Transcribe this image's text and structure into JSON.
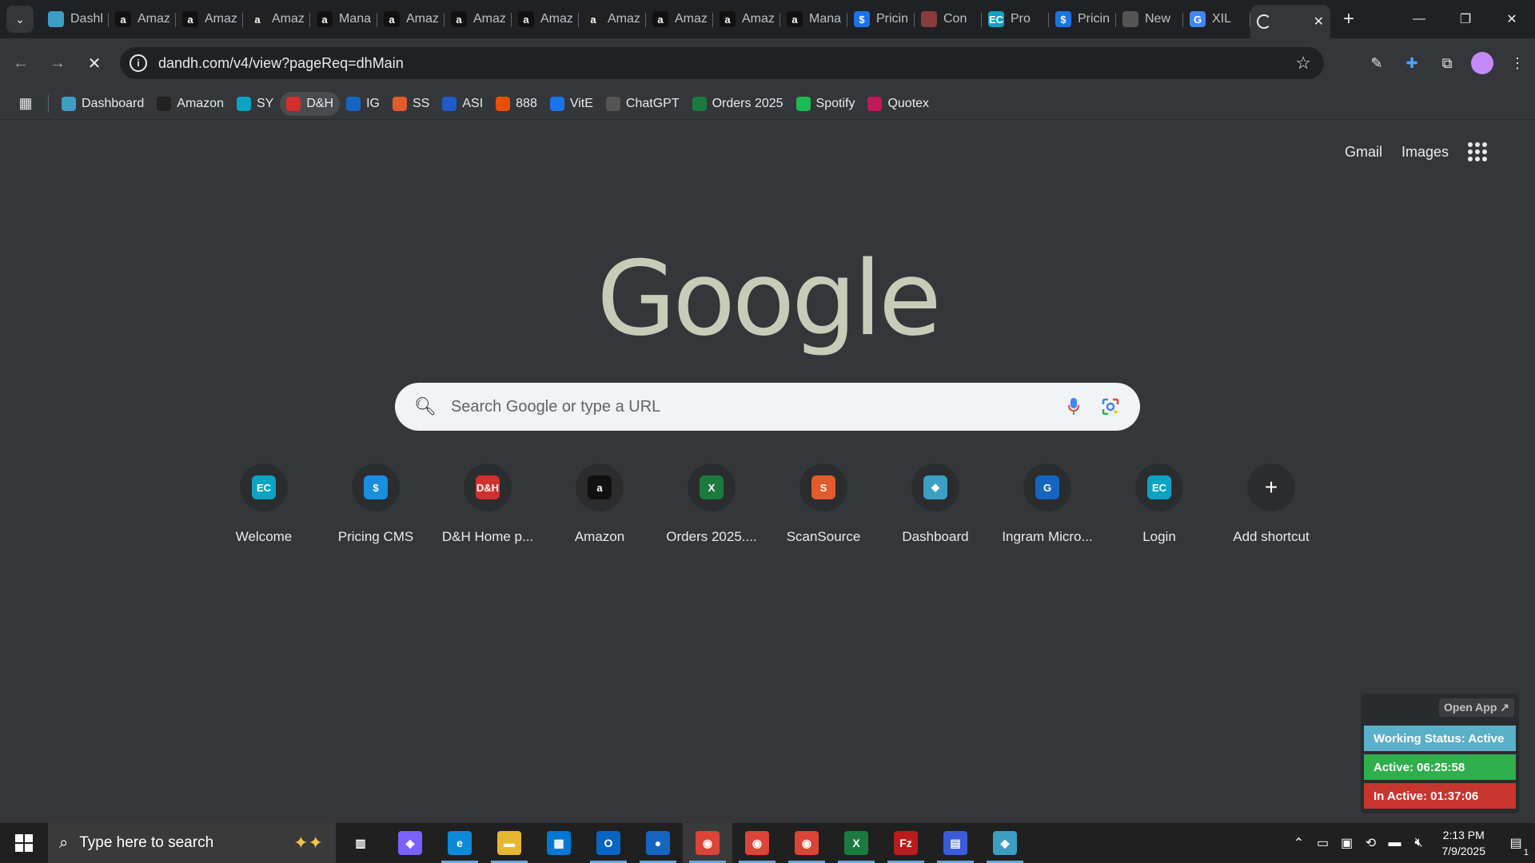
{
  "tabs": [
    {
      "title": "Dashboard",
      "icon": "dashboard-diamond-icon",
      "color": "#3d9ec4"
    },
    {
      "title": "Amazon",
      "icon": "amazon-icon",
      "color": "#111"
    },
    {
      "title": "Amazon",
      "icon": "amazon-icon",
      "color": "#111"
    },
    {
      "title": "Amazon",
      "icon": "amazon-icon",
      "color": "#222"
    },
    {
      "title": "Manage",
      "icon": "amazon-icon",
      "color": "#111"
    },
    {
      "title": "Amazon",
      "icon": "amazon-icon",
      "color": "#111"
    },
    {
      "title": "Amazon",
      "icon": "amazon-icon",
      "color": "#111"
    },
    {
      "title": "Amazon",
      "icon": "amazon-icon",
      "color": "#111"
    },
    {
      "title": "Amazon",
      "icon": "amazon-icon",
      "color": "#222"
    },
    {
      "title": "Amazon",
      "icon": "amazon-icon",
      "color": "#111"
    },
    {
      "title": "Amazon",
      "icon": "amazon-icon",
      "color": "#111"
    },
    {
      "title": "Manage",
      "icon": "amazon-icon",
      "color": "#111"
    },
    {
      "title": "Pricing",
      "icon": "dollar-icon",
      "color": "#1a73e8"
    },
    {
      "title": "Con",
      "icon": "chart-icon",
      "color": "#8a3b3b"
    },
    {
      "title": "Pro",
      "icon": "ec-icon",
      "color": "#0aa3c2"
    },
    {
      "title": "Pricing",
      "icon": "dollar-icon",
      "color": "#1a73e8"
    },
    {
      "title": "New",
      "icon": "chatgpt-icon",
      "color": "#555"
    },
    {
      "title": "XIL",
      "icon": "google-icon",
      "color": "#4285f4"
    }
  ],
  "active_tab": {
    "title": "",
    "status": "loading"
  },
  "address": {
    "url": "dandh.com/v4/view?pageReq=dhMain"
  },
  "bookmarks": [
    {
      "label": "Dashboard",
      "color": "#3d9ec4"
    },
    {
      "label": "Amazon",
      "color": "#222"
    },
    {
      "label": "SY",
      "color": "#0aa3c2"
    },
    {
      "label": "D&H",
      "color": "#d32f2f",
      "highlight": true
    },
    {
      "label": "IG",
      "color": "#1565c0"
    },
    {
      "label": "SS",
      "color": "#e25b2c"
    },
    {
      "label": "ASI",
      "color": "#1e5bc6"
    },
    {
      "label": "888",
      "color": "#e65100"
    },
    {
      "label": "VitE",
      "color": "#1a73e8"
    },
    {
      "label": "ChatGPT",
      "color": "#555"
    },
    {
      "label": "Orders 2025",
      "color": "#1d7a3e"
    },
    {
      "label": "Spotify",
      "color": "#1db954"
    },
    {
      "label": "Quotex",
      "color": "#c2185b"
    }
  ],
  "ntp": {
    "gmail": "Gmail",
    "images": "Images",
    "logo": "Google",
    "search_placeholder": "Search Google or type a URL",
    "shortcuts": [
      {
        "label": "Welcome",
        "icon": "ec-icon",
        "glyph": "EC",
        "color": "#0aa3c2"
      },
      {
        "label": "Pricing CMS",
        "icon": "dollar-icon",
        "glyph": "$",
        "color": "#1a8fe0"
      },
      {
        "label": "D&H Home p...",
        "icon": "dandh-icon",
        "glyph": "D&H",
        "color": "#d32f2f"
      },
      {
        "label": "Amazon",
        "icon": "amazon-icon",
        "glyph": "a",
        "color": "#111"
      },
      {
        "label": "Orders 2025....",
        "icon": "excel-icon",
        "glyph": "X",
        "color": "#1d7a3e"
      },
      {
        "label": "ScanSource",
        "icon": "scansource-icon",
        "glyph": "S",
        "color": "#e25b2c"
      },
      {
        "label": "Dashboard",
        "icon": "dashboard-diamond-icon",
        "glyph": "◆",
        "color": "#3d9ec4"
      },
      {
        "label": "Ingram Micro...",
        "icon": "ingram-icon",
        "glyph": "G",
        "color": "#1565c0"
      },
      {
        "label": "Login",
        "icon": "ec-icon",
        "glyph": "EC",
        "color": "#0aa3c2"
      },
      {
        "label": "Add shortcut",
        "icon": "plus-icon",
        "glyph": "+",
        "color": "#2b2c2e"
      }
    ]
  },
  "widget": {
    "open_app": "Open App ↗",
    "working_status": "Working Status: Active",
    "active": "Active: 06:25:58",
    "inactive": "In Active: 01:37:06",
    "colors": {
      "status": "#5ab0c8",
      "active": "#2fae4c",
      "inactive": "#c8352e"
    }
  },
  "taskbar": {
    "search_placeholder": "Type here to search",
    "time": "2:13 PM",
    "date": "7/9/2025",
    "notification_count": "1",
    "apps": [
      {
        "name": "task-view",
        "glyph": "▥",
        "color": "transparent"
      },
      {
        "name": "copilot",
        "glyph": "◈",
        "color": "#7b61ff"
      },
      {
        "name": "edge",
        "glyph": "e",
        "color": "#0c8ad8"
      },
      {
        "name": "file-explorer",
        "glyph": "▬",
        "color": "#e8b730"
      },
      {
        "name": "store",
        "glyph": "▦",
        "color": "#0078d4"
      },
      {
        "name": "outlook",
        "glyph": "O",
        "color": "#0a64c2"
      },
      {
        "name": "calendar",
        "glyph": "●",
        "color": "#1565c0"
      },
      {
        "name": "chrome",
        "glyph": "◉",
        "color": "#db4437"
      },
      {
        "name": "chrome-2",
        "glyph": "◉",
        "color": "#db4437"
      },
      {
        "name": "chrome-3",
        "glyph": "◉",
        "color": "#db4437"
      },
      {
        "name": "excel",
        "glyph": "X",
        "color": "#1d7a3e"
      },
      {
        "name": "filezilla",
        "glyph": "Fz",
        "color": "#b91c1c"
      },
      {
        "name": "calculator",
        "glyph": "▤",
        "color": "#3b5bdb"
      },
      {
        "name": "dashboard-app",
        "glyph": "◆",
        "color": "#3d9ec4"
      }
    ]
  }
}
